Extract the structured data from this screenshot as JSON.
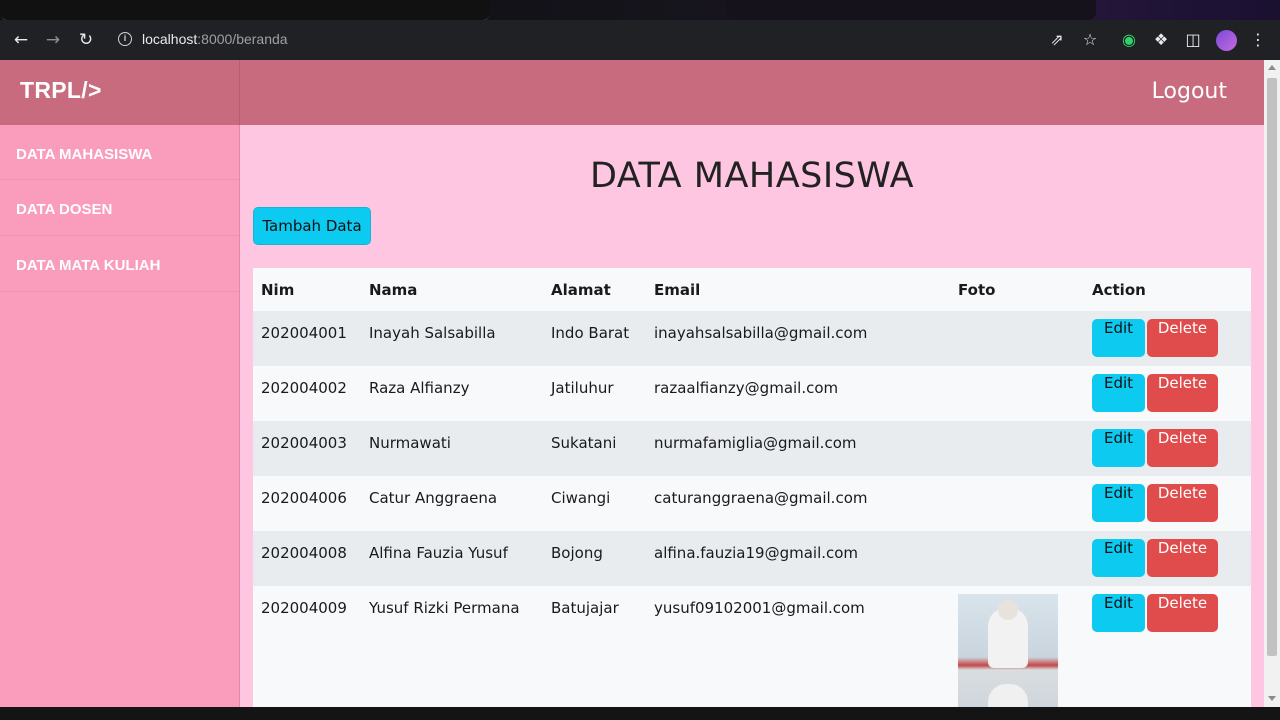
{
  "browser": {
    "url_host": "localhost",
    "url_path": ":8000/beranda"
  },
  "app": {
    "brand": "TRPL/>",
    "logout_label": "Logout"
  },
  "sidebar": {
    "items": [
      {
        "label": "DATA MAHASISWA"
      },
      {
        "label": "DATA DOSEN"
      },
      {
        "label": "DATA MATA KULIAH"
      }
    ]
  },
  "main": {
    "title": "DATA MAHASISWA",
    "add_button": "Tambah Data",
    "table": {
      "headers": [
        "Nim",
        "Nama",
        "Alamat",
        "Email",
        "Foto",
        "Action"
      ],
      "edit_label": "Edit",
      "delete_label": "Delete",
      "rows": [
        {
          "nim": "202004001",
          "nama": "Inayah Salsabilla",
          "alamat": "Indo Barat",
          "email": "inayahsalsabilla@gmail.com"
        },
        {
          "nim": "202004002",
          "nama": "Raza Alfianzy",
          "alamat": "Jatiluhur",
          "email": "razaalfianzy@gmail.com"
        },
        {
          "nim": "202004003",
          "nama": "Nurmawati",
          "alamat": "Sukatani",
          "email": "nurmafamiglia@gmail.com"
        },
        {
          "nim": "202004006",
          "nama": "Catur Anggraena",
          "alamat": "Ciwangi",
          "email": "caturanggraena@gmail.com"
        },
        {
          "nim": "202004008",
          "nama": "Alfina Fauzia Yusuf",
          "alamat": "Bojong",
          "email": "alfina.fauzia19@gmail.com"
        },
        {
          "nim": "202004009",
          "nama": "Yusuf Rizki Permana",
          "alamat": "Batujajar",
          "email": "yusuf09102001@gmail.com"
        }
      ]
    }
  },
  "colors": {
    "header": "#c96b7e",
    "sidebar": "#fa9cbb",
    "content_bg": "#ffc6e2",
    "info_button": "#0dcaf0",
    "danger_button": "#e04b4b"
  }
}
